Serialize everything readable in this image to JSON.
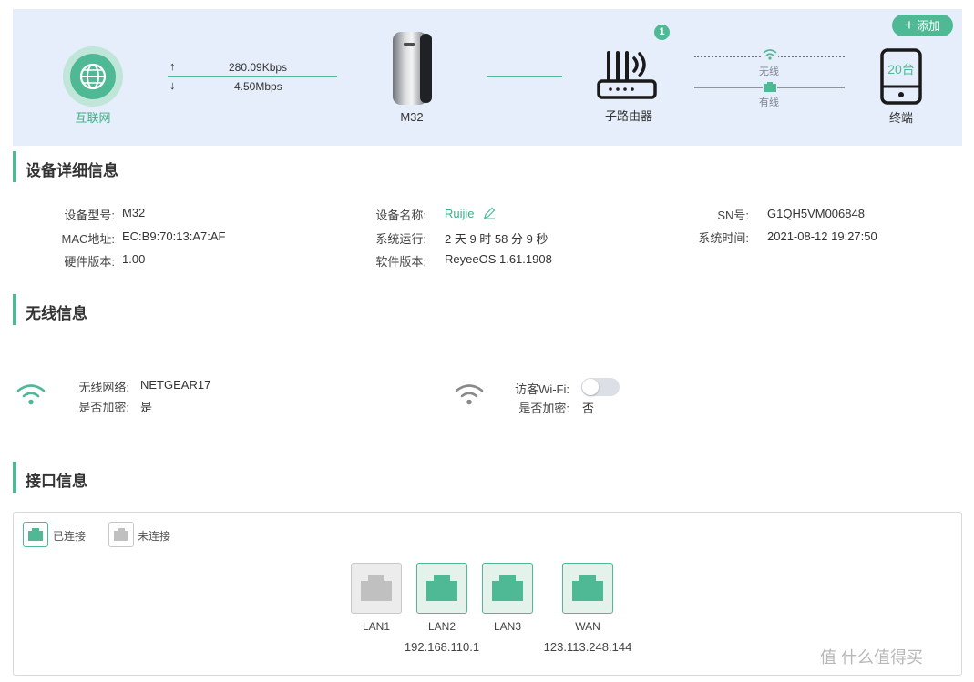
{
  "topology": {
    "internet_label": "互联网",
    "upload_speed": "280.09Kbps",
    "download_speed": "4.50Mbps",
    "main_device_label": "M32",
    "sub_router_label": "子路由器",
    "sub_router_count": "1",
    "wireless_label": "无线",
    "wired_label": "有线",
    "terminal_label": "终端",
    "terminal_count": "20台",
    "add_button": "添加",
    "add_icon": "+",
    "upload_arrow": "↑",
    "download_arrow": "↓"
  },
  "device_info": {
    "title": "设备详细信息",
    "model_label": "设备型号:",
    "model_value": "M32",
    "mac_label": "MAC地址:",
    "mac_value": "EC:B9:70:13:A7:AF",
    "hw_label": "硬件版本:",
    "hw_value": "1.00",
    "name_label": "设备名称:",
    "name_value": "Ruijie",
    "uptime_label": "系统运行:",
    "uptime_value": "2 天 9 时 58 分 9 秒",
    "sw_label": "软件版本:",
    "sw_value": "ReyeeOS 1.61.1908",
    "sn_label": "SN号:",
    "sn_value": "G1QH5VM006848",
    "systime_label": "系统时间:",
    "systime_value": "2021-08-12 19:27:50"
  },
  "wireless_info": {
    "title": "无线信息",
    "network_label": "无线网络:",
    "network_value": "NETGEAR17",
    "encrypted_label": "是否加密:",
    "encrypted_value": "是",
    "guest_label": "访客Wi-Fi:",
    "guest_enabled": false,
    "guest_encrypted_label": "是否加密:",
    "guest_encrypted_value": "否"
  },
  "interface_info": {
    "title": "接口信息",
    "legend_connected": "已连接",
    "legend_disconnected": "未连接",
    "ports": [
      {
        "name": "LAN1",
        "connected": false,
        "ip": ""
      },
      {
        "name": "LAN2",
        "connected": true,
        "ip": "192.168.110.1"
      },
      {
        "name": "LAN3",
        "connected": true,
        "ip": ""
      },
      {
        "name": "WAN",
        "connected": true,
        "ip": "123.113.248.144"
      }
    ]
  },
  "watermark": "值 什么值得买",
  "colors": {
    "accent": "#4fb894",
    "banner_bg": "#e6eefb",
    "port_off": "#c0c0c0"
  }
}
